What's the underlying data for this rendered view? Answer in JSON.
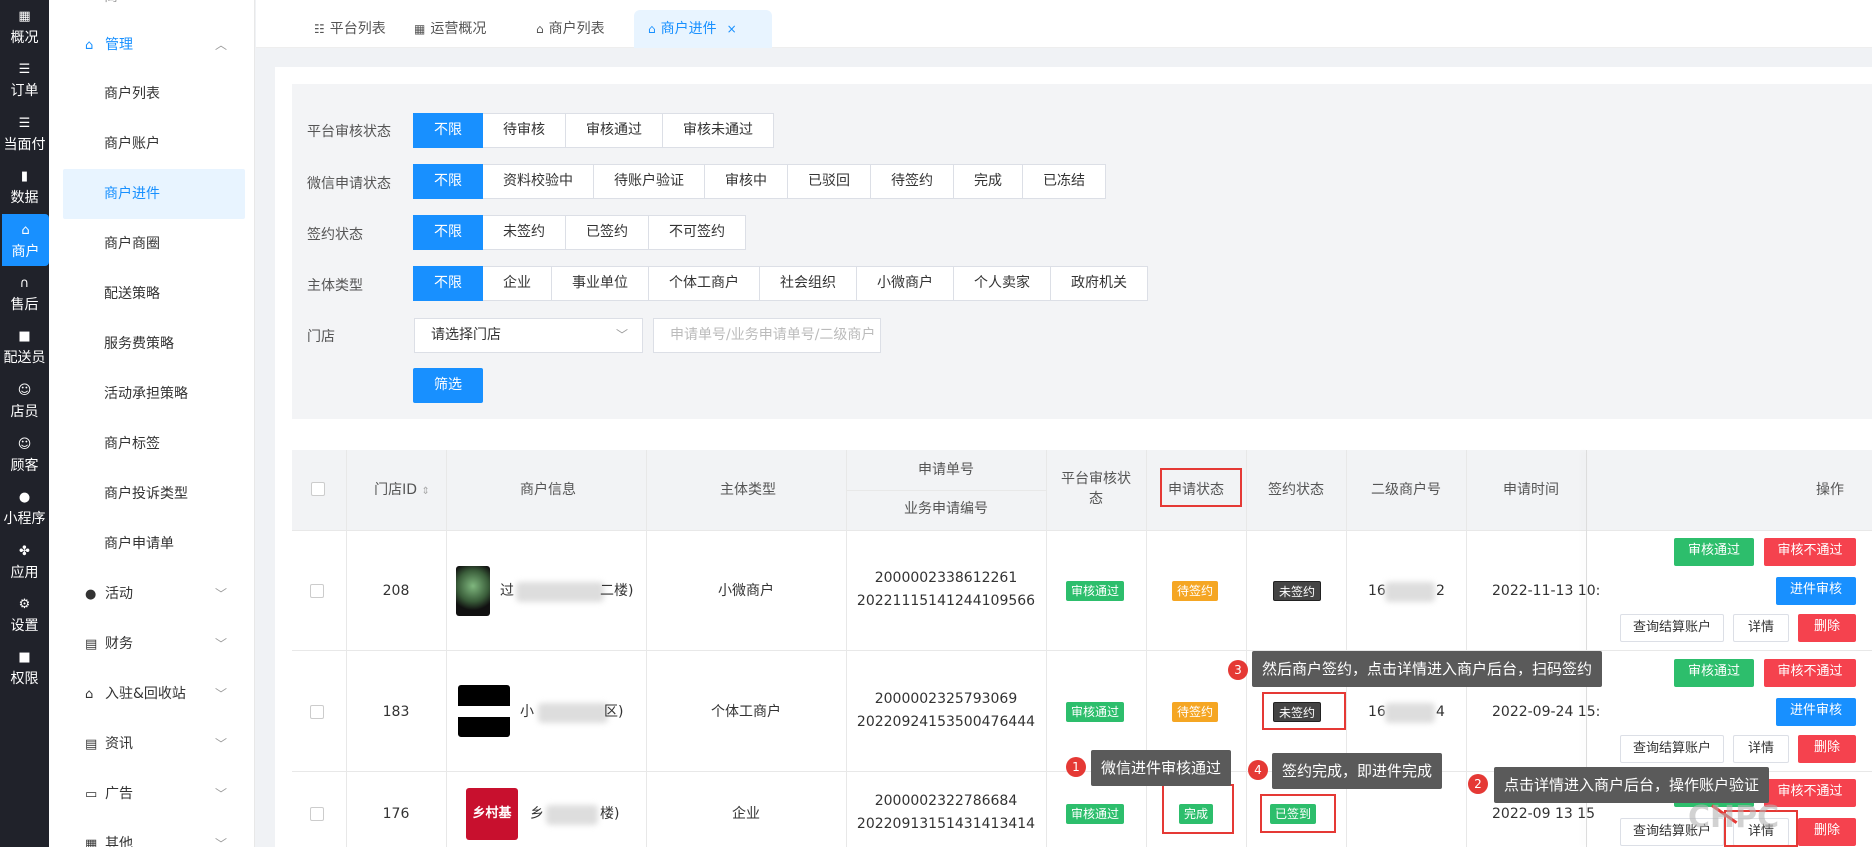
{
  "rail": [
    {
      "icon": "grid-icon",
      "label": "概况"
    },
    {
      "icon": "list-icon",
      "label": "订单"
    },
    {
      "icon": "list-icon",
      "label": "当面付"
    },
    {
      "icon": "bar-chart-icon",
      "label": "数据"
    },
    {
      "icon": "store-icon",
      "label": "商户"
    },
    {
      "icon": "headset-icon",
      "label": "售后"
    },
    {
      "icon": "truck-icon",
      "label": "配送员"
    },
    {
      "icon": "users-icon",
      "label": "店员"
    },
    {
      "icon": "user-icon",
      "label": "顾客"
    },
    {
      "icon": "wechat-icon",
      "label": "小程序"
    },
    {
      "icon": "apps-icon",
      "label": "应用"
    },
    {
      "icon": "settings-icon",
      "label": "设置"
    },
    {
      "icon": "lock-icon",
      "label": "权限"
    }
  ],
  "submenu": {
    "top_partial": "商",
    "group_manage": "管理",
    "items": [
      "商户列表",
      "商户账户",
      "商户进件",
      "商户商圈",
      "配送策略",
      "服务费策略",
      "活动承担策略",
      "商户标签",
      "商户投诉类型",
      "商户申请单"
    ],
    "groups": [
      "活动",
      "财务",
      "入驻&回收站",
      "资讯",
      "广告",
      "其他"
    ]
  },
  "tabs": [
    "平台列表",
    "运营概况",
    "商户列表",
    "商户进件"
  ],
  "filters": {
    "platform_status": {
      "label": "平台审核状态",
      "options": [
        "不限",
        "待审核",
        "审核通过",
        "审核未通过"
      ]
    },
    "wechat_status": {
      "label": "微信申请状态",
      "options": [
        "不限",
        "资料校验中",
        "待账户验证",
        "审核中",
        "已驳回",
        "待签约",
        "完成",
        "已冻结"
      ]
    },
    "sign_status": {
      "label": "签约状态",
      "options": [
        "不限",
        "未签约",
        "已签约",
        "不可签约"
      ]
    },
    "subject_type": {
      "label": "主体类型",
      "options": [
        "不限",
        "企业",
        "事业单位",
        "个体工商户",
        "社会组织",
        "小微商户",
        "个人卖家",
        "政府机关"
      ]
    },
    "store": {
      "label": "门店",
      "select_value": "请选择门店",
      "search_placeholder": "申请单号/业务申请单号/二级商户"
    },
    "submit": "筛选"
  },
  "table": {
    "headers": {
      "store_id": "门店ID",
      "merchant": "商户信息",
      "subject": "主体类型",
      "apply_no": "申请单号",
      "biz_no": "业务申请编号",
      "platform_status_1": "平台审核状",
      "platform_status_2": "态",
      "apply_status": "申请状态",
      "sign_status": "签约状态",
      "sub_merchant": "二级商户号",
      "apply_time": "申请时间",
      "ops": "操作"
    },
    "rows": [
      {
        "id": "208",
        "name_a": "过",
        "name_b": "二楼)",
        "subject": "小微商户",
        "apply_no": "2000002338612261",
        "biz_no": "20221115141244109566",
        "platform": "审核通过",
        "status": "待签约",
        "sign": "未签约",
        "sub_a": "16",
        "sub_b": "2",
        "time": "2022-11-13 10:"
      },
      {
        "id": "183",
        "name_a": "小",
        "name_b": "区)",
        "subject": "个体工商户",
        "apply_no": "2000002325793069",
        "biz_no": "20220924153500476444",
        "platform": "审核通过",
        "status": "待签约",
        "sign": "未签约",
        "sub_a": "16",
        "sub_b": "4",
        "time": "2022-09-24 15:"
      },
      {
        "id": "176",
        "name_a": "乡",
        "name_b": "楼)",
        "subject": "企业",
        "apply_no": "2000002322786684",
        "biz_no": "20220913151431413414",
        "platform": "审核通过",
        "status": "完成",
        "sign": "已签到",
        "sub_a": "",
        "sub_b": "",
        "time": "2022-09 13 15"
      }
    ],
    "row3_logo": "乡村基",
    "ops": {
      "approve": "审核通过",
      "reject": "审核不通过",
      "submit_review": "进件审核",
      "query_account": "查询结算账户",
      "detail": "详情",
      "delete": "删除"
    }
  },
  "annotations": [
    {
      "num": "1",
      "text": "微信进件审核通过"
    },
    {
      "num": "2",
      "text": "点击详情进入商户后台，操作账户验证"
    },
    {
      "num": "3",
      "text": "然后商户签约，点击详情进入商户后台，扫码签约"
    },
    {
      "num": "4",
      "text": "签约完成，即进件完成"
    }
  ],
  "watermark": "CHPC"
}
